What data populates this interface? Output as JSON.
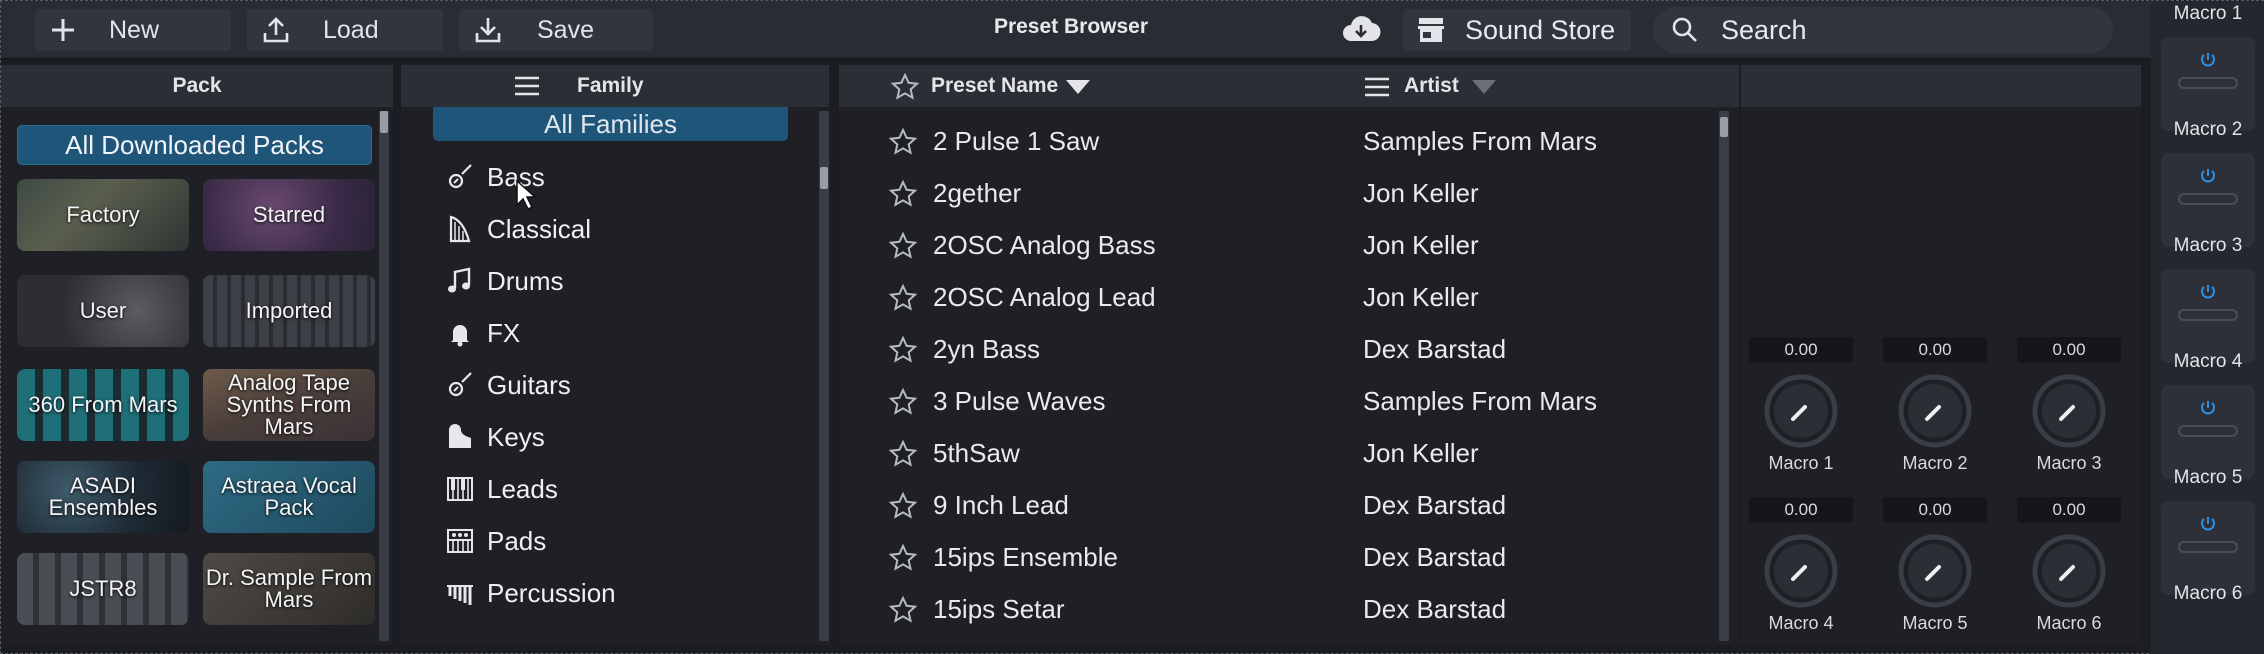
{
  "toolbar": {
    "new_label": "New",
    "load_label": "Load",
    "save_label": "Save",
    "title": "Preset Browser",
    "store_label": "Sound Store",
    "search_placeholder": "Search"
  },
  "columns": {
    "pack": "Pack",
    "family": "Family",
    "preset_name": "Preset Name",
    "artist": "Artist"
  },
  "packs": {
    "all_label": "All Downloaded Packs",
    "tiles": [
      {
        "label": "Factory"
      },
      {
        "label": "Starred"
      },
      {
        "label": "User"
      },
      {
        "label": "Imported"
      },
      {
        "label": "360 From Mars"
      },
      {
        "label": "Analog Tape Synths From Mars"
      },
      {
        "label": "ASADI Ensembles"
      },
      {
        "label": "Astraea Vocal Pack"
      },
      {
        "label": "JSTR8"
      },
      {
        "label": "Dr. Sample From Mars"
      }
    ]
  },
  "families": {
    "all_label": "All Families",
    "items": [
      {
        "label": "Bass",
        "icon": "guitar-icon"
      },
      {
        "label": "Classical",
        "icon": "harp-icon"
      },
      {
        "label": "Drums",
        "icon": "music-note-icon"
      },
      {
        "label": "FX",
        "icon": "bell-icon"
      },
      {
        "label": "Guitars",
        "icon": "guitar-icon"
      },
      {
        "label": "Keys",
        "icon": "piano-icon"
      },
      {
        "label": "Leads",
        "icon": "keyboard-icon"
      },
      {
        "label": "Pads",
        "icon": "synth-icon"
      },
      {
        "label": "Percussion",
        "icon": "xylophone-icon"
      }
    ]
  },
  "presets": [
    {
      "name": "2 Pulse 1 Saw",
      "artist": "Samples From Mars"
    },
    {
      "name": "2gether",
      "artist": "Jon Keller"
    },
    {
      "name": "2OSC Analog Bass",
      "artist": "Jon Keller"
    },
    {
      "name": "2OSC Analog Lead",
      "artist": "Jon Keller"
    },
    {
      "name": "2yn Bass",
      "artist": "Dex Barstad"
    },
    {
      "name": "3 Pulse Waves",
      "artist": "Samples From Mars"
    },
    {
      "name": "5thSaw",
      "artist": "Jon Keller"
    },
    {
      "name": "9 Inch Lead",
      "artist": "Dex Barstad"
    },
    {
      "name": "15ips Ensemble",
      "artist": "Dex Barstad"
    },
    {
      "name": "15ips Setar",
      "artist": "Dex Barstad"
    }
  ],
  "macros": [
    {
      "label": "Macro 1",
      "value": "0.00"
    },
    {
      "label": "Macro 2",
      "value": "0.00"
    },
    {
      "label": "Macro 3",
      "value": "0.00"
    },
    {
      "label": "Macro 4",
      "value": "0.00"
    },
    {
      "label": "Macro 5",
      "value": "0.00"
    },
    {
      "label": "Macro 6",
      "value": "0.00"
    }
  ],
  "strip": {
    "labels": [
      "Macro 1",
      "Macro 2",
      "Macro 3",
      "Macro 4",
      "Macro 5",
      "Macro 6"
    ]
  },
  "colors": {
    "accent": "#1e5578",
    "power": "#2e8fe0",
    "panel": "#1e2026"
  }
}
